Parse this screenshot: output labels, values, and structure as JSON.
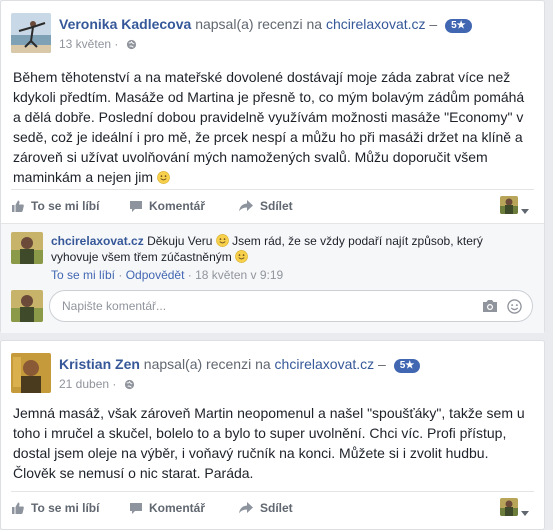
{
  "review1": {
    "author": "Veronika Kadlecova",
    "action_text": "napsal(a) recenzi na",
    "site": "chcirelaxovat.cz",
    "separator": "–",
    "rating_badge": "5★",
    "date": "13 květen",
    "dot": "·",
    "text": "Během těhotenství a na mateřské dovolené dostávají moje záda zabrat více než kdykoli předtím. Masáže od Martina je přesně to, co mým bolavým zádům pomáhá a dělá dobře. Poslední dobou pravidelně využívám možnosti masáže \"Economy\" v sedě, což je ideální i pro mě, že prcek nespí a můžu ho při masáži držet na klíně a zároveň si užívat uvolňování mých namožených svalů. Můžu doporučit všem maminkám a nejen jim",
    "like_label": "To se mi líbí",
    "comment_label": "Komentář",
    "share_label": "Sdílet",
    "reply": {
      "author": "chcirelaxovat.cz",
      "text_part1": "Děkuju Veru",
      "text_part2": "Jsem rád, že se vždy podaří najít způsob, který vyhovuje všem třem zúčastněným",
      "like_label": "To se mi líbí",
      "reply_label": "Odpovědět",
      "time": "18 květen v 9:19"
    },
    "compose_placeholder": "Napište komentář..."
  },
  "review2": {
    "author": "Kristian Zen",
    "action_text": "napsal(a) recenzi na",
    "site": "chcirelaxovat.cz",
    "separator": "–",
    "rating_badge": "5★",
    "date": "21 duben",
    "dot": "·",
    "text": "Jemná masáž, však zároveň Martin neopomenul a našel \"spoušťáky\", takže sem u toho i mručel a skučel, bolelo to a bylo to super uvolnění. Chci víc. Profi přístup, dostal jsem oleje na výběr, i voňavý ručník na konci. Můžete si i zvolit hudbu. Člověk se nemusí o nic starat. Paráda.",
    "like_label": "To se mi líbí",
    "comment_label": "Komentář",
    "share_label": "Sdílet"
  },
  "icons": {
    "like": "thumbs-up-icon",
    "comment": "speech-bubble-icon",
    "share": "share-arrow-icon",
    "globe": "globe-icon",
    "camera": "camera-icon",
    "smiley": "smiley-icon"
  },
  "colors": {
    "link_blue": "#365899",
    "badge_blue": "#4267b2",
    "muted": "#90949c",
    "background": "#e9ebee"
  }
}
